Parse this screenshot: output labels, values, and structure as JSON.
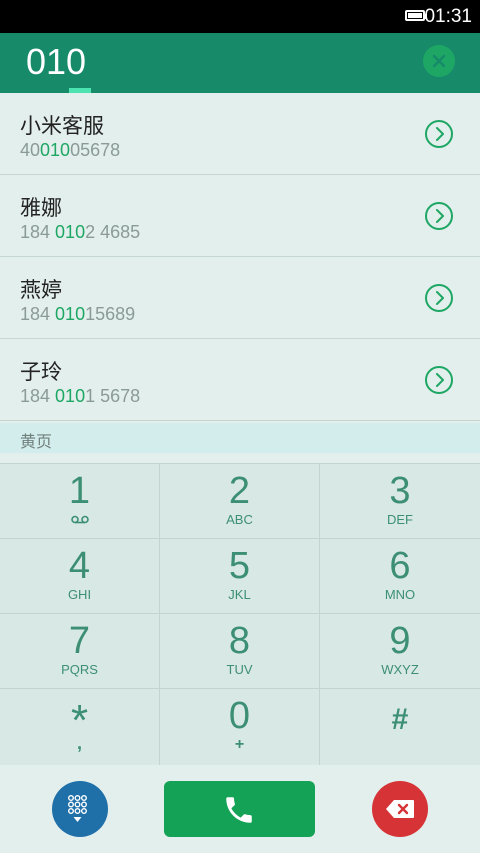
{
  "status_bar": {
    "time": "01:31"
  },
  "header": {
    "query": "010"
  },
  "results": [
    {
      "name": "小米客服",
      "num_pre": "40",
      "num_hl": "010",
      "num_post": "05678"
    },
    {
      "name": "雅娜",
      "num_pre": "184 ",
      "num_hl": "010",
      "num_post": "2 4685"
    },
    {
      "name": "燕婷",
      "num_pre": "184 ",
      "num_hl": "010",
      "num_post": "15689"
    },
    {
      "name": "子玲",
      "num_pre": "184 ",
      "num_hl": "010",
      "num_post": "1 5678"
    }
  ],
  "section_label": "黄页",
  "keypad": [
    {
      "digit": "1",
      "letters": ""
    },
    {
      "digit": "2",
      "letters": "ABC"
    },
    {
      "digit": "3",
      "letters": "DEF"
    },
    {
      "digit": "4",
      "letters": "GHI"
    },
    {
      "digit": "5",
      "letters": "JKL"
    },
    {
      "digit": "6",
      "letters": "MNO"
    },
    {
      "digit": "7",
      "letters": "PQRS"
    },
    {
      "digit": "8",
      "letters": "TUV"
    },
    {
      "digit": "9",
      "letters": "WXYZ"
    },
    {
      "digit": "*",
      "letters": ","
    },
    {
      "digit": "0",
      "letters": "+"
    },
    {
      "digit": "#",
      "letters": ""
    }
  ],
  "icons": {
    "voicemail": "voicemail-icon",
    "dialpad": "dialpad-icon",
    "call": "phone-icon",
    "delete": "backspace-icon",
    "clear": "close-icon",
    "detail": "chevron-right-icon"
  },
  "colors": {
    "header": "#178a6a",
    "accent": "#1ea764",
    "call_button": "#14a256",
    "dialpad_button": "#1f6fa8",
    "delete_button": "#d63336"
  }
}
